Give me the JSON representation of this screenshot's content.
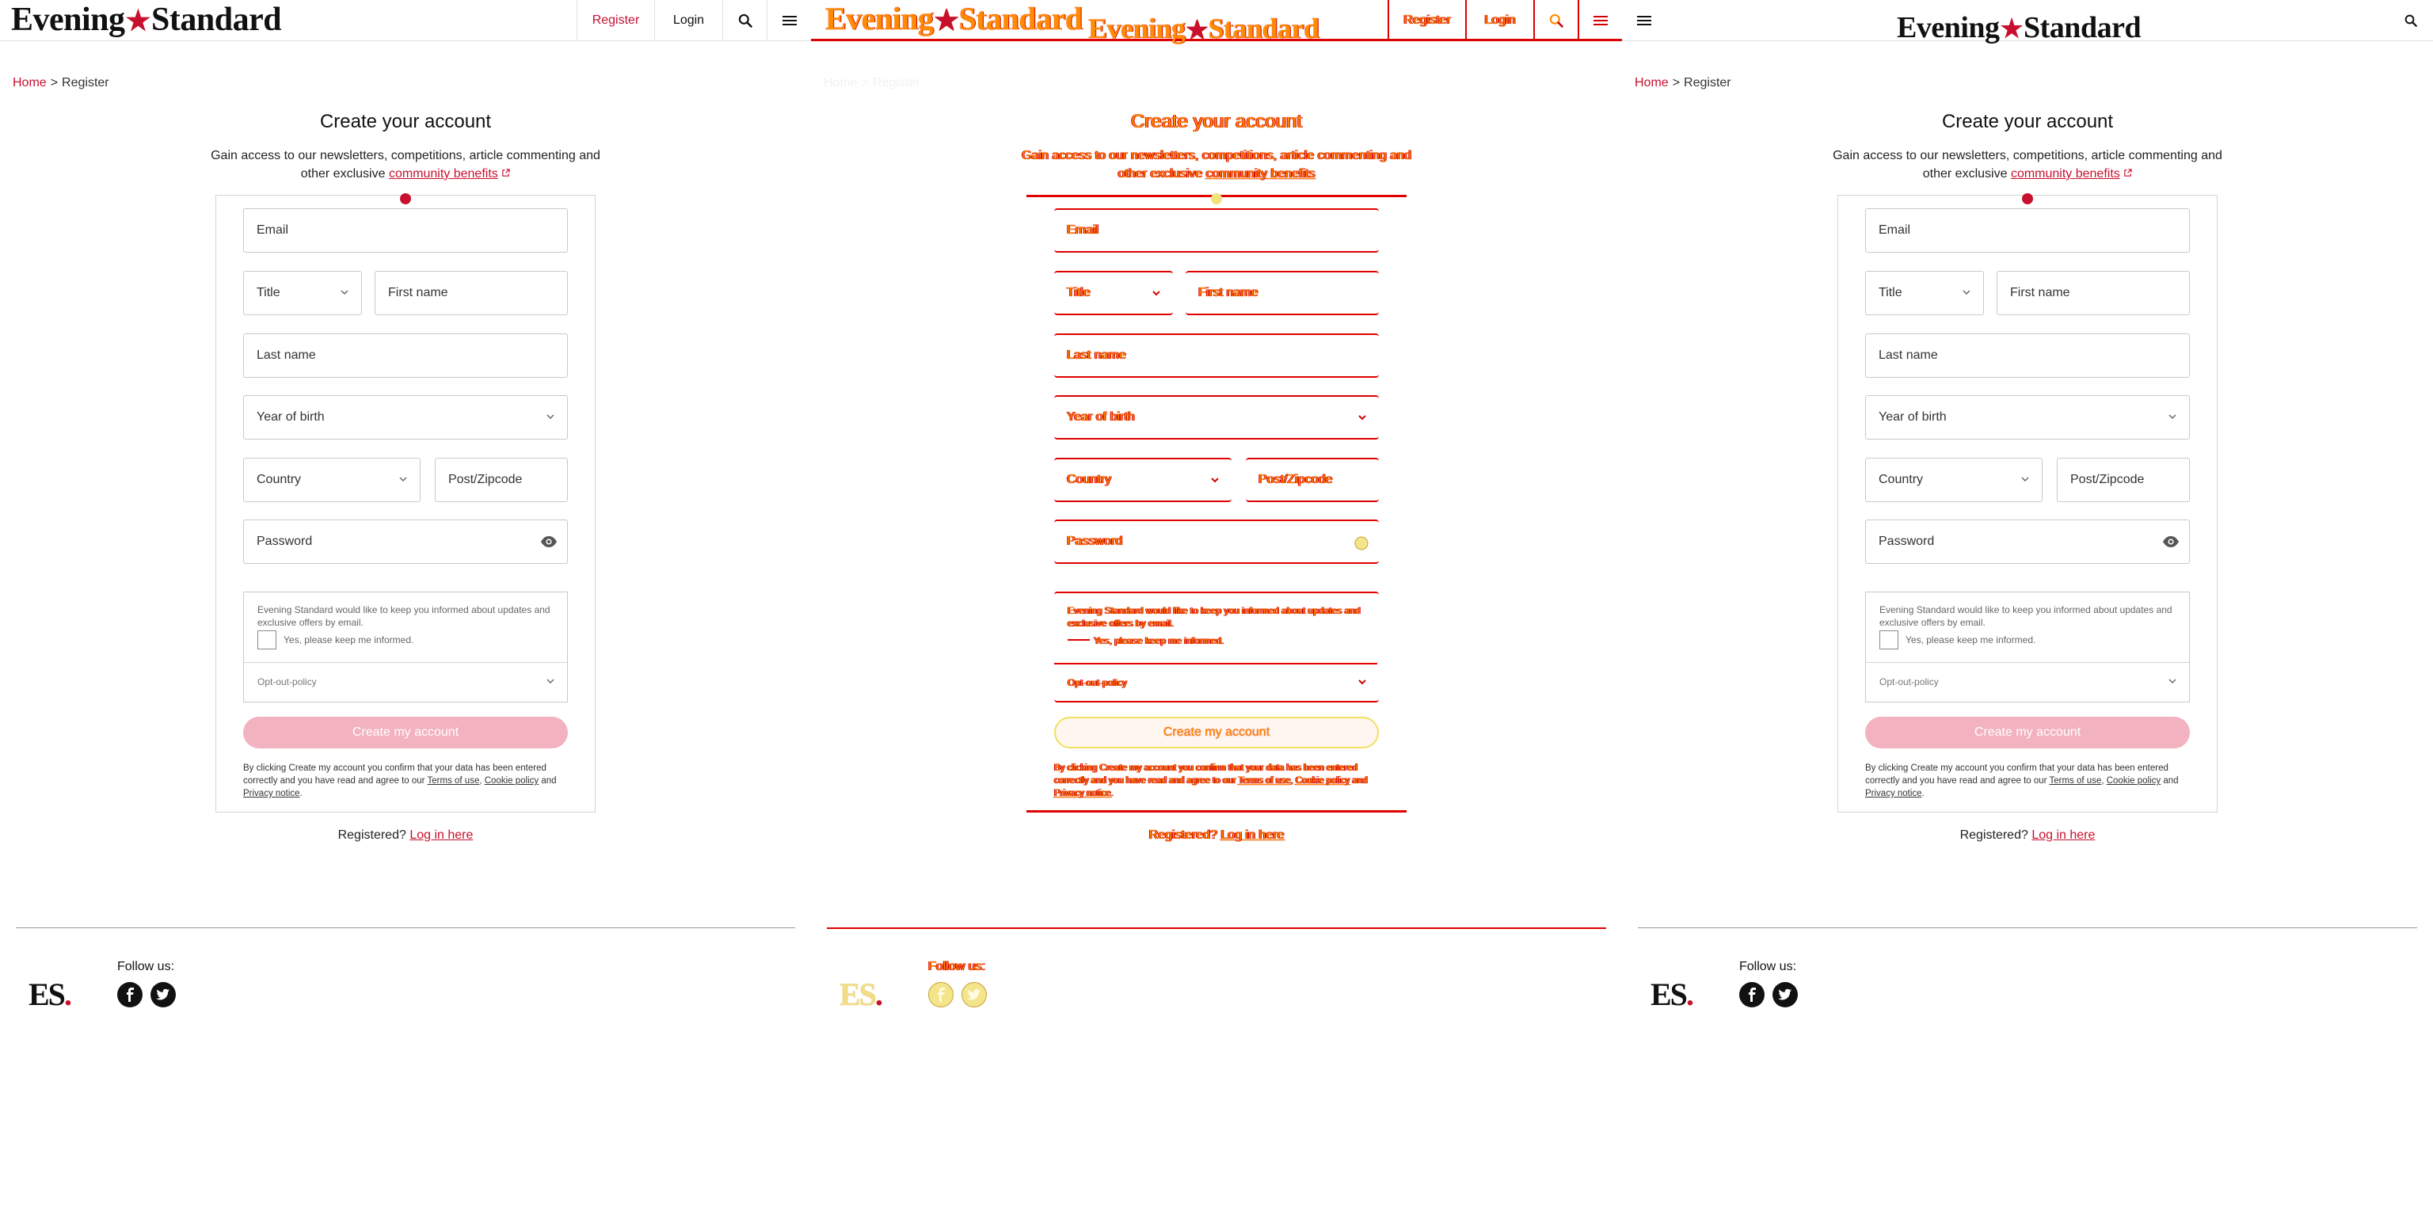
{
  "header": {
    "logo_word_1": "Evening",
    "logo_word_2": "Standard",
    "logo_star": "★",
    "register_label": "Register",
    "login_label": "Login"
  },
  "breadcrumb": {
    "home": "Home",
    "separator": ">",
    "current": "Register"
  },
  "form": {
    "heading": "Create your account",
    "intro": "Gain access to our newsletters, competitions, article commenting and other exclusive",
    "benefits_link": "community benefits",
    "fields": {
      "email": "Email",
      "title": "Title",
      "first_name": "First name",
      "last_name": "Last name",
      "year_of_birth": "Year of birth",
      "country": "Country",
      "postcode": "Post/Zipcode",
      "password": "Password"
    },
    "consent_text": "Evening Standard would like to keep you informed about updates and exclusive offers by email.",
    "consent_checkbox_label": "Yes, please keep me informed.",
    "optout_label": "Opt-out-policy",
    "create_button": "Create my account",
    "legal_prefix": "By clicking Create my account you confirm that your data has been entered correctly and you have read and agree to our",
    "terms_link": "Terms of use",
    "cookie_link": "Cookie policy",
    "legal_and": "and",
    "privacy_link": "Privacy notice",
    "registered_prefix": "Registered?",
    "login_link": "Log in here"
  },
  "footer": {
    "es_logo": "ES",
    "es_dot": ".",
    "follow_label": "Follow us:",
    "social": [
      "facebook-icon",
      "twitter-icon"
    ]
  },
  "colors": {
    "brand_red": "#c8102e",
    "button_pink": "#f3b2bf",
    "overlay_red": "#e00000",
    "overlay_orange": "#ff8c00"
  }
}
